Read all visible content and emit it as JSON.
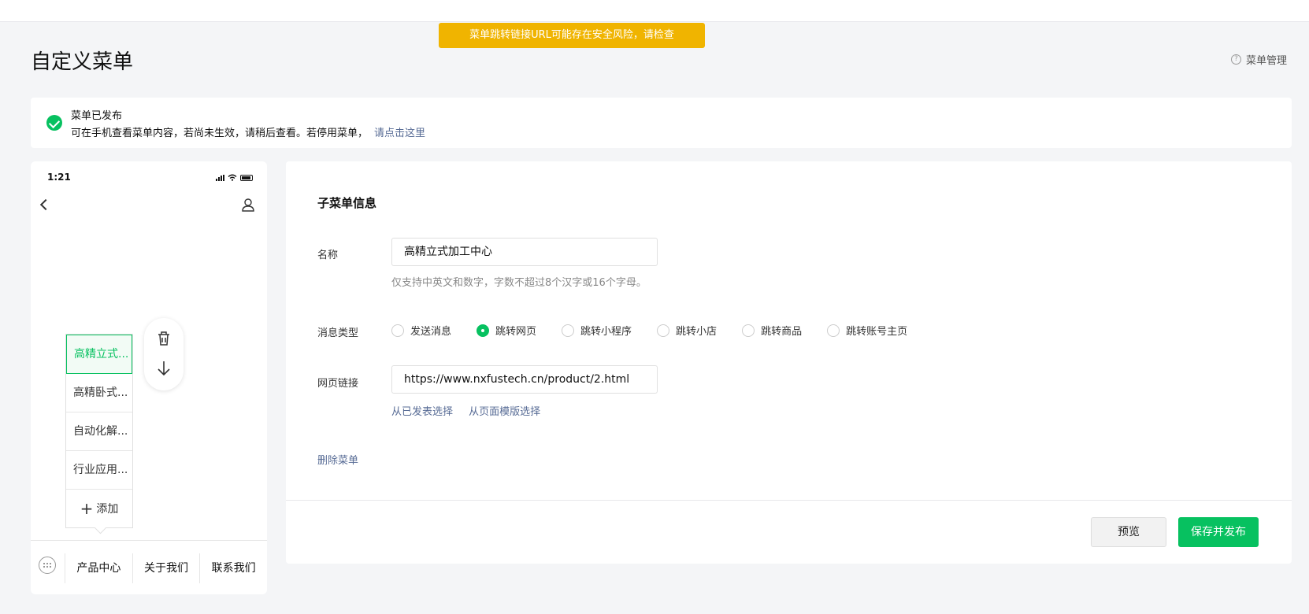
{
  "toast": "菜单跳转链接URL可能存在安全风险，请检查",
  "header": {
    "title": "自定义菜单",
    "help_link": "菜单管理"
  },
  "notice": {
    "title": "菜单已发布",
    "text": "可在手机查看菜单内容，若尚未生效，请稍后查看。若停用菜单，",
    "link": "请点击这里"
  },
  "phone": {
    "time": "1:21",
    "submenu": [
      "高精立式...",
      "高精卧式...",
      "自动化解...",
      "行业应用..."
    ],
    "add_label": "添加",
    "bottom_menu": [
      "产品中心",
      "关于我们",
      "联系我们"
    ]
  },
  "form": {
    "section_title": "子菜单信息",
    "name_label": "名称",
    "name_value": "高精立式加工中心",
    "name_hint": "仅支持中英文和数字，字数不超过8个汉字或16个字母。",
    "type_label": "消息类型",
    "types": [
      "发送消息",
      "跳转网页",
      "跳转小程序",
      "跳转小店",
      "跳转商品",
      "跳转账号主页"
    ],
    "selected_type": "跳转网页",
    "url_label": "网页链接",
    "url_value": "https://www.nxfustech.cn/product/2.html",
    "pick_published": "从已发表选择",
    "pick_template": "从页面模版选择",
    "delete_label": "删除菜单"
  },
  "actions": {
    "preview": "预览",
    "save_publish": "保存并发布"
  },
  "colors": {
    "brand_green": "#07c160",
    "warning": "#f0b400",
    "link": "#576b95"
  }
}
